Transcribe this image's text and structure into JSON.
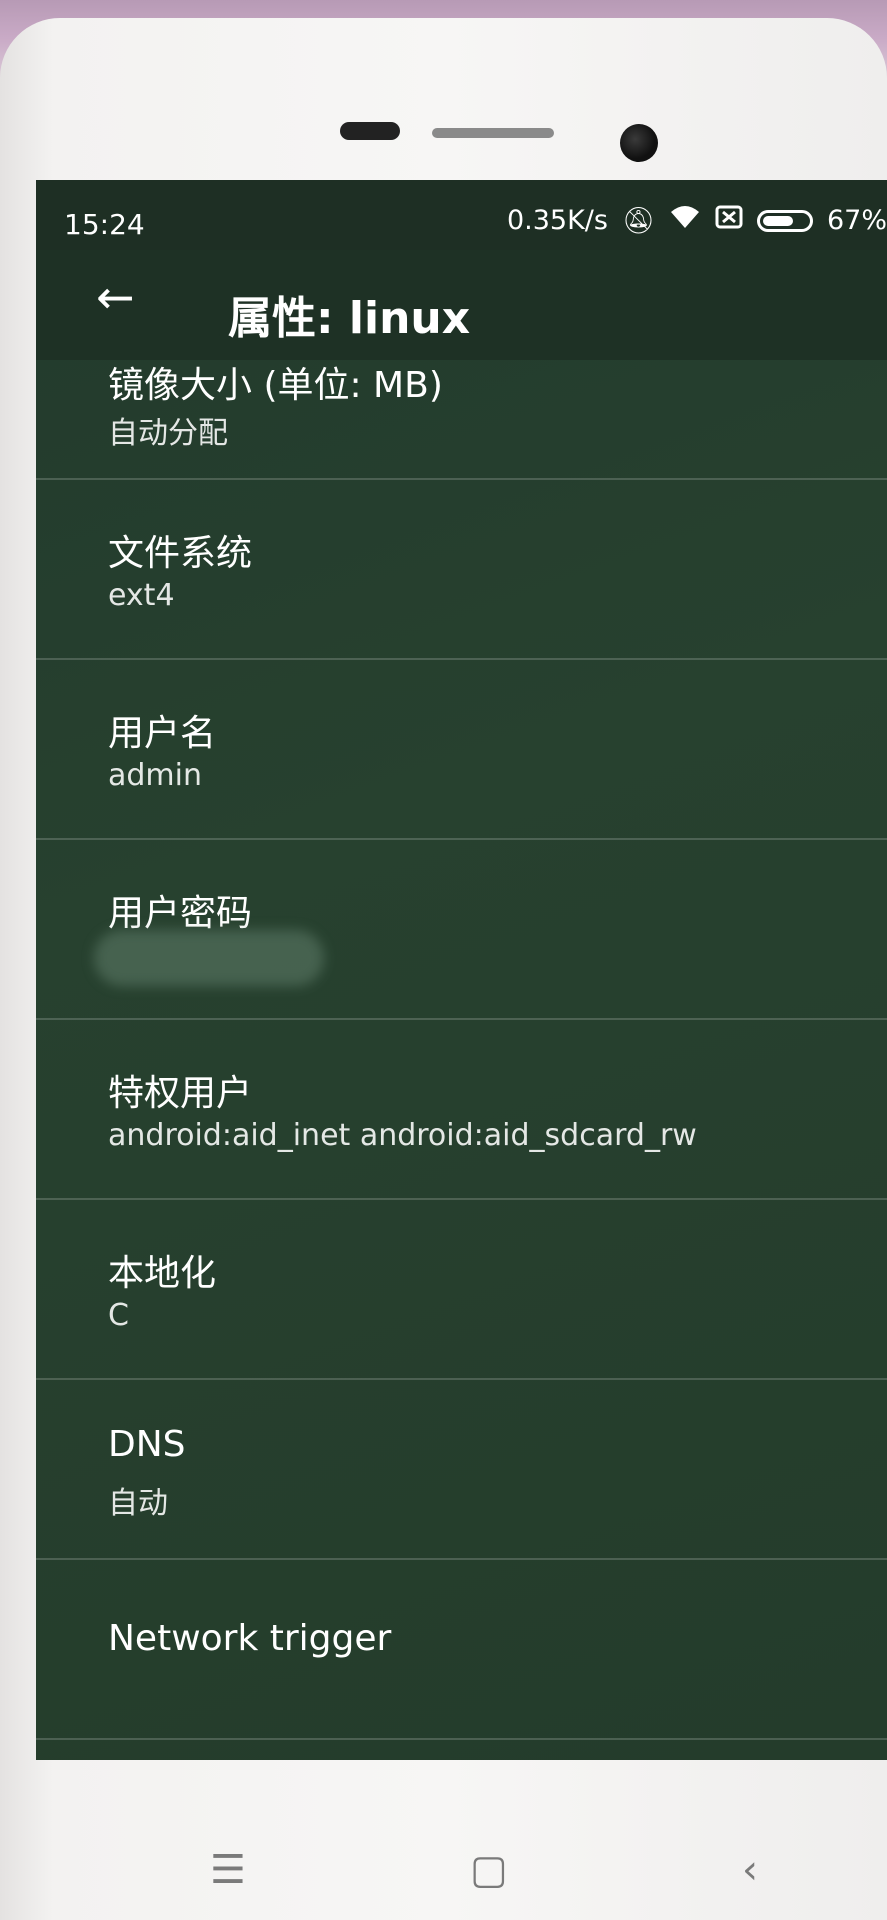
{
  "status_bar": {
    "time": "15:24",
    "network_speed": "0.35K/s",
    "battery_text": "67%",
    "icons": [
      "mute-icon",
      "wifi-icon",
      "sim-icon",
      "battery-icon"
    ]
  },
  "app_bar": {
    "title": "属性: linux",
    "back_icon": "←"
  },
  "settings": [
    {
      "title": "镜像大小 (单位: MB)",
      "value": "自动分配"
    },
    {
      "title": "文件系统",
      "value": "ext4"
    },
    {
      "title": "用户名",
      "value": "admin"
    },
    {
      "title": "用户密码",
      "value": ""
    },
    {
      "title": "特权用户",
      "value": "android:aid_inet android:aid_sdcard_rw"
    },
    {
      "title": "本地化",
      "value": "C"
    },
    {
      "title": "DNS",
      "value": "自动"
    },
    {
      "title": "Network trigger",
      "value": ""
    }
  ],
  "nav_bar": {
    "menu": "☰",
    "home": "▢",
    "back": "‹"
  }
}
